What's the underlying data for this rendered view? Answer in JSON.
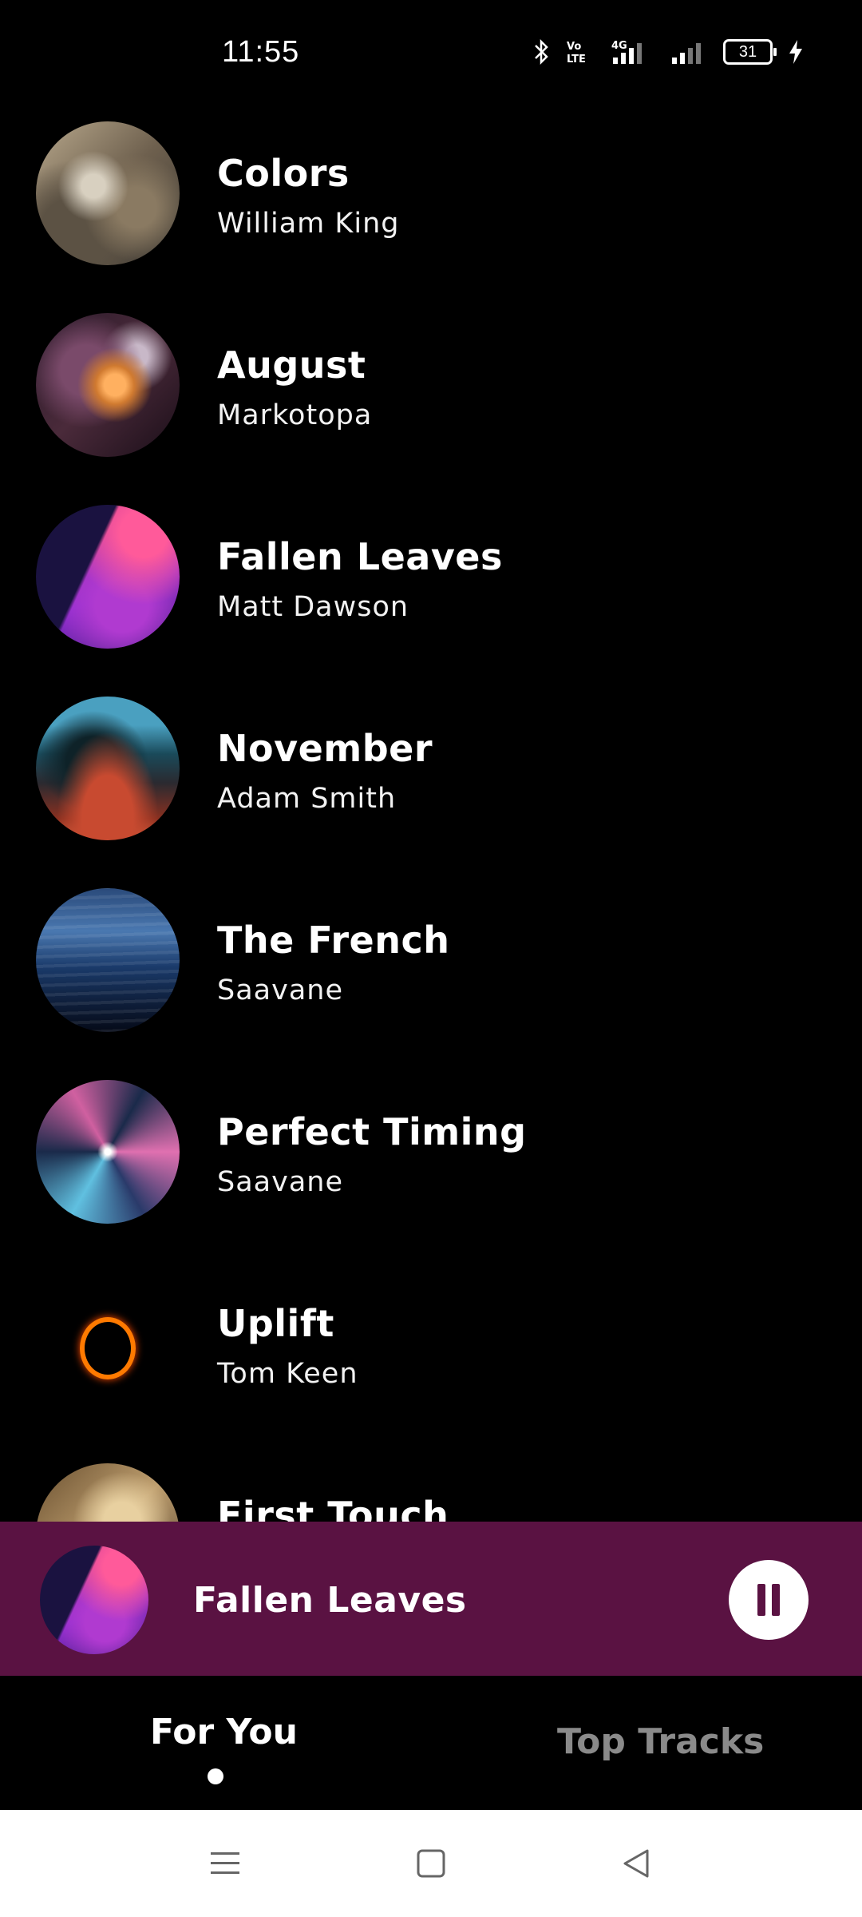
{
  "status_bar": {
    "time": "11:55",
    "battery": "31",
    "icons": [
      "bluetooth-icon",
      "volte-icon",
      "4g-signal-icon",
      "signal-icon",
      "battery-icon",
      "charging-icon"
    ]
  },
  "tracks": [
    {
      "title": "Colors",
      "artist": "William King"
    },
    {
      "title": "August",
      "artist": "Markotopa"
    },
    {
      "title": "Fallen Leaves",
      "artist": "Matt Dawson"
    },
    {
      "title": "November",
      "artist": "Adam Smith"
    },
    {
      "title": "The French",
      "artist": "Saavane"
    },
    {
      "title": "Perfect Timing",
      "artist": "Saavane"
    },
    {
      "title": "Uplift",
      "artist": "Tom Keen"
    },
    {
      "title": "First Touch",
      "artist": ""
    }
  ],
  "now_playing": {
    "title": "Fallen Leaves",
    "state_icon": "pause-icon"
  },
  "tabs": [
    {
      "label": "For You",
      "active": true
    },
    {
      "label": "Top Tracks",
      "active": false
    }
  ],
  "nav_bar": {
    "icons": [
      "menu-icon",
      "home-icon",
      "back-icon"
    ]
  },
  "colors": {
    "background": "#000000",
    "now_playing_bg": "#5a1242",
    "active_tab": "#ffffff",
    "inactive_tab": "#8a8a8a"
  }
}
